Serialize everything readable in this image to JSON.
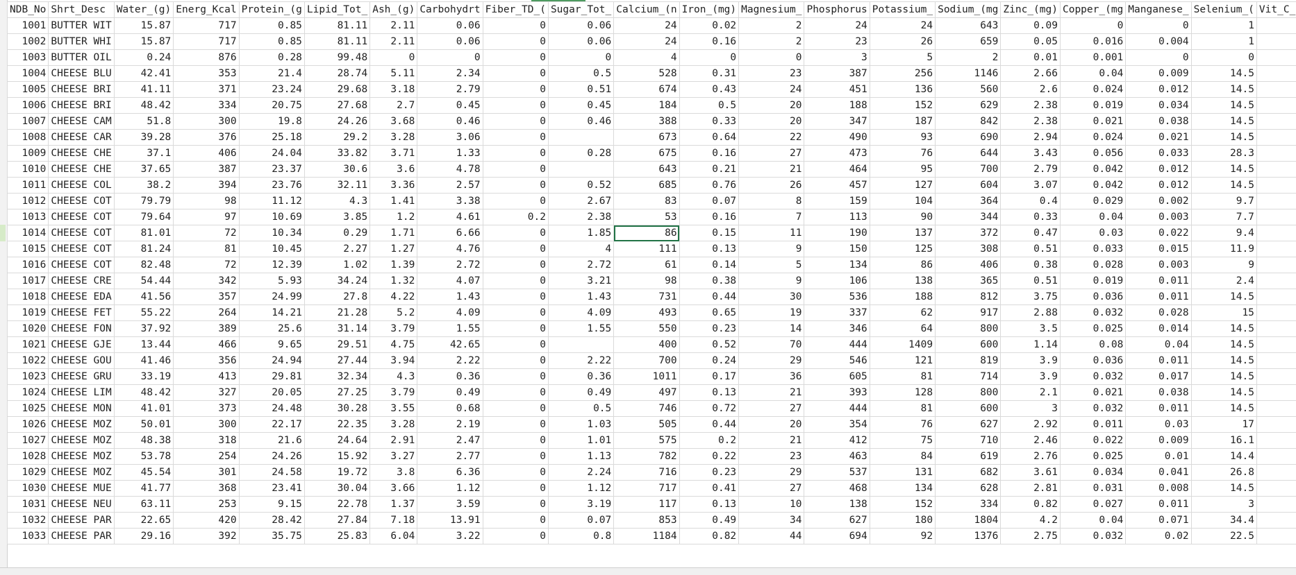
{
  "spreadsheet": {
    "columns": [
      "NDB_No",
      "Shrt_Desc",
      "Water_(g)",
      "Energ_Kcal",
      "Protein_(g",
      "Lipid_Tot_",
      "Ash_(g)",
      "Carbohydrt",
      "Fiber_TD_(",
      "Sugar_Tot_",
      "Calcium_(n",
      "Iron_(mg)",
      "Magnesium_",
      "Phosphorus",
      "Potassium_",
      "Sodium_(mg",
      "Zinc_(mg)",
      "Copper_(mg",
      "Manganese_",
      "Selenium_(",
      "Vit_C_"
    ],
    "selected_cell": {
      "row": 13,
      "column": "Calcium_(n"
    },
    "selection_color": "#217346",
    "rows": [
      [
        "1001",
        "BUTTER WIT",
        "15.87",
        "717",
        "0.85",
        "81.11",
        "2.11",
        "0.06",
        "0",
        "0.06",
        "24",
        "0.02",
        "2",
        "24",
        "24",
        "643",
        "0.09",
        "0",
        "0",
        "1",
        ""
      ],
      [
        "1002",
        "BUTTER WHI",
        "15.87",
        "717",
        "0.85",
        "81.11",
        "2.11",
        "0.06",
        "0",
        "0.06",
        "24",
        "0.16",
        "2",
        "23",
        "26",
        "659",
        "0.05",
        "0.016",
        "0.004",
        "1",
        ""
      ],
      [
        "1003",
        "BUTTER OIL",
        "0.24",
        "876",
        "0.28",
        "99.48",
        "0",
        "0",
        "0",
        "0",
        "4",
        "0",
        "0",
        "3",
        "5",
        "2",
        "0.01",
        "0.001",
        "0",
        "0",
        ""
      ],
      [
        "1004",
        "CHEESE BLU",
        "42.41",
        "353",
        "21.4",
        "28.74",
        "5.11",
        "2.34",
        "0",
        "0.5",
        "528",
        "0.31",
        "23",
        "387",
        "256",
        "1146",
        "2.66",
        "0.04",
        "0.009",
        "14.5",
        ""
      ],
      [
        "1005",
        "CHEESE BRI",
        "41.11",
        "371",
        "23.24",
        "29.68",
        "3.18",
        "2.79",
        "0",
        "0.51",
        "674",
        "0.43",
        "24",
        "451",
        "136",
        "560",
        "2.6",
        "0.024",
        "0.012",
        "14.5",
        ""
      ],
      [
        "1006",
        "CHEESE BRI",
        "48.42",
        "334",
        "20.75",
        "27.68",
        "2.7",
        "0.45",
        "0",
        "0.45",
        "184",
        "0.5",
        "20",
        "188",
        "152",
        "629",
        "2.38",
        "0.019",
        "0.034",
        "14.5",
        ""
      ],
      [
        "1007",
        "CHEESE CAM",
        "51.8",
        "300",
        "19.8",
        "24.26",
        "3.68",
        "0.46",
        "0",
        "0.46",
        "388",
        "0.33",
        "20",
        "347",
        "187",
        "842",
        "2.38",
        "0.021",
        "0.038",
        "14.5",
        ""
      ],
      [
        "1008",
        "CHEESE CAR",
        "39.28",
        "376",
        "25.18",
        "29.2",
        "3.28",
        "3.06",
        "0",
        "",
        "673",
        "0.64",
        "22",
        "490",
        "93",
        "690",
        "2.94",
        "0.024",
        "0.021",
        "14.5",
        ""
      ],
      [
        "1009",
        "CHEESE CHE",
        "37.1",
        "406",
        "24.04",
        "33.82",
        "3.71",
        "1.33",
        "0",
        "0.28",
        "675",
        "0.16",
        "27",
        "473",
        "76",
        "644",
        "3.43",
        "0.056",
        "0.033",
        "28.3",
        ""
      ],
      [
        "1010",
        "CHEESE CHE",
        "37.65",
        "387",
        "23.37",
        "30.6",
        "3.6",
        "4.78",
        "0",
        "",
        "643",
        "0.21",
        "21",
        "464",
        "95",
        "700",
        "2.79",
        "0.042",
        "0.012",
        "14.5",
        ""
      ],
      [
        "1011",
        "CHEESE COL",
        "38.2",
        "394",
        "23.76",
        "32.11",
        "3.36",
        "2.57",
        "0",
        "0.52",
        "685",
        "0.76",
        "26",
        "457",
        "127",
        "604",
        "3.07",
        "0.042",
        "0.012",
        "14.5",
        ""
      ],
      [
        "1012",
        "CHEESE COT",
        "79.79",
        "98",
        "11.12",
        "4.3",
        "1.41",
        "3.38",
        "0",
        "2.67",
        "83",
        "0.07",
        "8",
        "159",
        "104",
        "364",
        "0.4",
        "0.029",
        "0.002",
        "9.7",
        ""
      ],
      [
        "1013",
        "CHEESE COT",
        "79.64",
        "97",
        "10.69",
        "3.85",
        "1.2",
        "4.61",
        "0.2",
        "2.38",
        "53",
        "0.16",
        "7",
        "113",
        "90",
        "344",
        "0.33",
        "0.04",
        "0.003",
        "7.7",
        ""
      ],
      [
        "1014",
        "CHEESE COT",
        "81.01",
        "72",
        "10.34",
        "0.29",
        "1.71",
        "6.66",
        "0",
        "1.85",
        "86",
        "0.15",
        "11",
        "190",
        "137",
        "372",
        "0.47",
        "0.03",
        "0.022",
        "9.4",
        ""
      ],
      [
        "1015",
        "CHEESE COT",
        "81.24",
        "81",
        "10.45",
        "2.27",
        "1.27",
        "4.76",
        "0",
        "4",
        "111",
        "0.13",
        "9",
        "150",
        "125",
        "308",
        "0.51",
        "0.033",
        "0.015",
        "11.9",
        ""
      ],
      [
        "1016",
        "CHEESE COT",
        "82.48",
        "72",
        "12.39",
        "1.02",
        "1.39",
        "2.72",
        "0",
        "2.72",
        "61",
        "0.14",
        "5",
        "134",
        "86",
        "406",
        "0.38",
        "0.028",
        "0.003",
        "9",
        ""
      ],
      [
        "1017",
        "CHEESE CRE",
        "54.44",
        "342",
        "5.93",
        "34.24",
        "1.32",
        "4.07",
        "0",
        "3.21",
        "98",
        "0.38",
        "9",
        "106",
        "138",
        "365",
        "0.51",
        "0.019",
        "0.011",
        "2.4",
        ""
      ],
      [
        "1018",
        "CHEESE EDA",
        "41.56",
        "357",
        "24.99",
        "27.8",
        "4.22",
        "1.43",
        "0",
        "1.43",
        "731",
        "0.44",
        "30",
        "536",
        "188",
        "812",
        "3.75",
        "0.036",
        "0.011",
        "14.5",
        ""
      ],
      [
        "1019",
        "CHEESE FET",
        "55.22",
        "264",
        "14.21",
        "21.28",
        "5.2",
        "4.09",
        "0",
        "4.09",
        "493",
        "0.65",
        "19",
        "337",
        "62",
        "917",
        "2.88",
        "0.032",
        "0.028",
        "15",
        ""
      ],
      [
        "1020",
        "CHEESE FON",
        "37.92",
        "389",
        "25.6",
        "31.14",
        "3.79",
        "1.55",
        "0",
        "1.55",
        "550",
        "0.23",
        "14",
        "346",
        "64",
        "800",
        "3.5",
        "0.025",
        "0.014",
        "14.5",
        ""
      ],
      [
        "1021",
        "CHEESE GJE",
        "13.44",
        "466",
        "9.65",
        "29.51",
        "4.75",
        "42.65",
        "0",
        "",
        "400",
        "0.52",
        "70",
        "444",
        "1409",
        "600",
        "1.14",
        "0.08",
        "0.04",
        "14.5",
        ""
      ],
      [
        "1022",
        "CHEESE GOU",
        "41.46",
        "356",
        "24.94",
        "27.44",
        "3.94",
        "2.22",
        "0",
        "2.22",
        "700",
        "0.24",
        "29",
        "546",
        "121",
        "819",
        "3.9",
        "0.036",
        "0.011",
        "14.5",
        ""
      ],
      [
        "1023",
        "CHEESE GRU",
        "33.19",
        "413",
        "29.81",
        "32.34",
        "4.3",
        "0.36",
        "0",
        "0.36",
        "1011",
        "0.17",
        "36",
        "605",
        "81",
        "714",
        "3.9",
        "0.032",
        "0.017",
        "14.5",
        ""
      ],
      [
        "1024",
        "CHEESE LIM",
        "48.42",
        "327",
        "20.05",
        "27.25",
        "3.79",
        "0.49",
        "0",
        "0.49",
        "497",
        "0.13",
        "21",
        "393",
        "128",
        "800",
        "2.1",
        "0.021",
        "0.038",
        "14.5",
        ""
      ],
      [
        "1025",
        "CHEESE MON",
        "41.01",
        "373",
        "24.48",
        "30.28",
        "3.55",
        "0.68",
        "0",
        "0.5",
        "746",
        "0.72",
        "27",
        "444",
        "81",
        "600",
        "3",
        "0.032",
        "0.011",
        "14.5",
        ""
      ],
      [
        "1026",
        "CHEESE MOZ",
        "50.01",
        "300",
        "22.17",
        "22.35",
        "3.28",
        "2.19",
        "0",
        "1.03",
        "505",
        "0.44",
        "20",
        "354",
        "76",
        "627",
        "2.92",
        "0.011",
        "0.03",
        "17",
        ""
      ],
      [
        "1027",
        "CHEESE MOZ",
        "48.38",
        "318",
        "21.6",
        "24.64",
        "2.91",
        "2.47",
        "0",
        "1.01",
        "575",
        "0.2",
        "21",
        "412",
        "75",
        "710",
        "2.46",
        "0.022",
        "0.009",
        "16.1",
        ""
      ],
      [
        "1028",
        "CHEESE MOZ",
        "53.78",
        "254",
        "24.26",
        "15.92",
        "3.27",
        "2.77",
        "0",
        "1.13",
        "782",
        "0.22",
        "23",
        "463",
        "84",
        "619",
        "2.76",
        "0.025",
        "0.01",
        "14.4",
        ""
      ],
      [
        "1029",
        "CHEESE MOZ",
        "45.54",
        "301",
        "24.58",
        "19.72",
        "3.8",
        "6.36",
        "0",
        "2.24",
        "716",
        "0.23",
        "29",
        "537",
        "131",
        "682",
        "3.61",
        "0.034",
        "0.041",
        "26.8",
        ""
      ],
      [
        "1030",
        "CHEESE MUE",
        "41.77",
        "368",
        "23.41",
        "30.04",
        "3.66",
        "1.12",
        "0",
        "1.12",
        "717",
        "0.41",
        "27",
        "468",
        "134",
        "628",
        "2.81",
        "0.031",
        "0.008",
        "14.5",
        ""
      ],
      [
        "1031",
        "CHEESE NEU",
        "63.11",
        "253",
        "9.15",
        "22.78",
        "1.37",
        "3.59",
        "0",
        "3.19",
        "117",
        "0.13",
        "10",
        "138",
        "152",
        "334",
        "0.82",
        "0.027",
        "0.011",
        "3",
        ""
      ],
      [
        "1032",
        "CHEESE PAR",
        "22.65",
        "420",
        "28.42",
        "27.84",
        "7.18",
        "13.91",
        "0",
        "0.07",
        "853",
        "0.49",
        "34",
        "627",
        "180",
        "1804",
        "4.2",
        "0.04",
        "0.071",
        "34.4",
        ""
      ],
      [
        "1033",
        "CHEESE PAR",
        "29.16",
        "392",
        "35.75",
        "25.83",
        "6.04",
        "3.22",
        "0",
        "0.8",
        "1184",
        "0.82",
        "44",
        "694",
        "92",
        "1376",
        "2.75",
        "0.032",
        "0.02",
        "22.5",
        ""
      ]
    ]
  }
}
